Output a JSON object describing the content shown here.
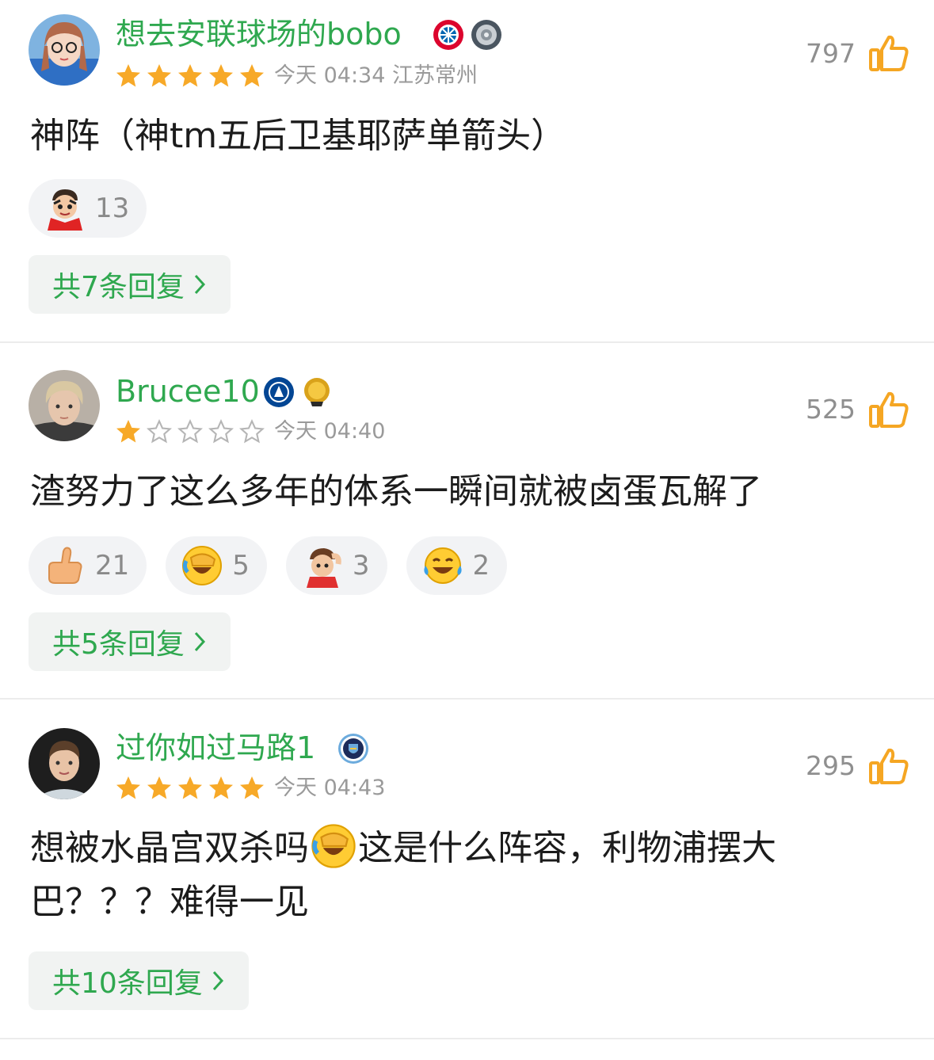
{
  "colors": {
    "accent_green": "#2fa84f",
    "star_gold": "#f7a928",
    "thumb_orange": "#f5a623",
    "meta_gray": "#9a9a9a",
    "chip_bg": "#f2f3f5"
  },
  "comments": [
    {
      "username": "想去安联球场的bobo",
      "badges": [
        "bayern-munich-badge-icon",
        "league-trophy-badge-icon"
      ],
      "rating": 5,
      "meta": "今天 04:34 江苏常州",
      "likes": "797",
      "text": "神阵（神tm五后卫基耶萨单箭头）",
      "reactions": [
        {
          "icon": "cartoon-face-icon",
          "count": "13"
        }
      ],
      "replies": "共7条回复"
    },
    {
      "username": "Brucee10",
      "badges": [
        "chelsea-badge-icon",
        "gold-medal-badge-icon"
      ],
      "rating": 1,
      "meta": "今天 04:40",
      "likes": "525",
      "text": "渣努力了这么多年的体系一瞬间就被卤蛋瓦解了",
      "reactions": [
        {
          "icon": "thumbs-up-emoji-icon",
          "count": "21"
        },
        {
          "icon": "facepalm-laugh-emoji-icon",
          "count": "5"
        },
        {
          "icon": "cartoon-head-scratch-icon",
          "count": "3"
        },
        {
          "icon": "tears-of-joy-emoji-icon",
          "count": "2"
        }
      ],
      "replies": "共5条回复"
    },
    {
      "username": "过你如过马路1",
      "badges": [
        "manchester-city-badge-icon"
      ],
      "rating": 5,
      "meta": "今天 04:43",
      "likes": "295",
      "text_part1": "想被水晶宫双杀吗",
      "text_emoji": "facepalm-laugh-emoji-icon",
      "text_part2": "这是什么阵容，利物浦摆大巴？？？难得一见",
      "reactions": [],
      "replies": "共10条回复"
    }
  ]
}
